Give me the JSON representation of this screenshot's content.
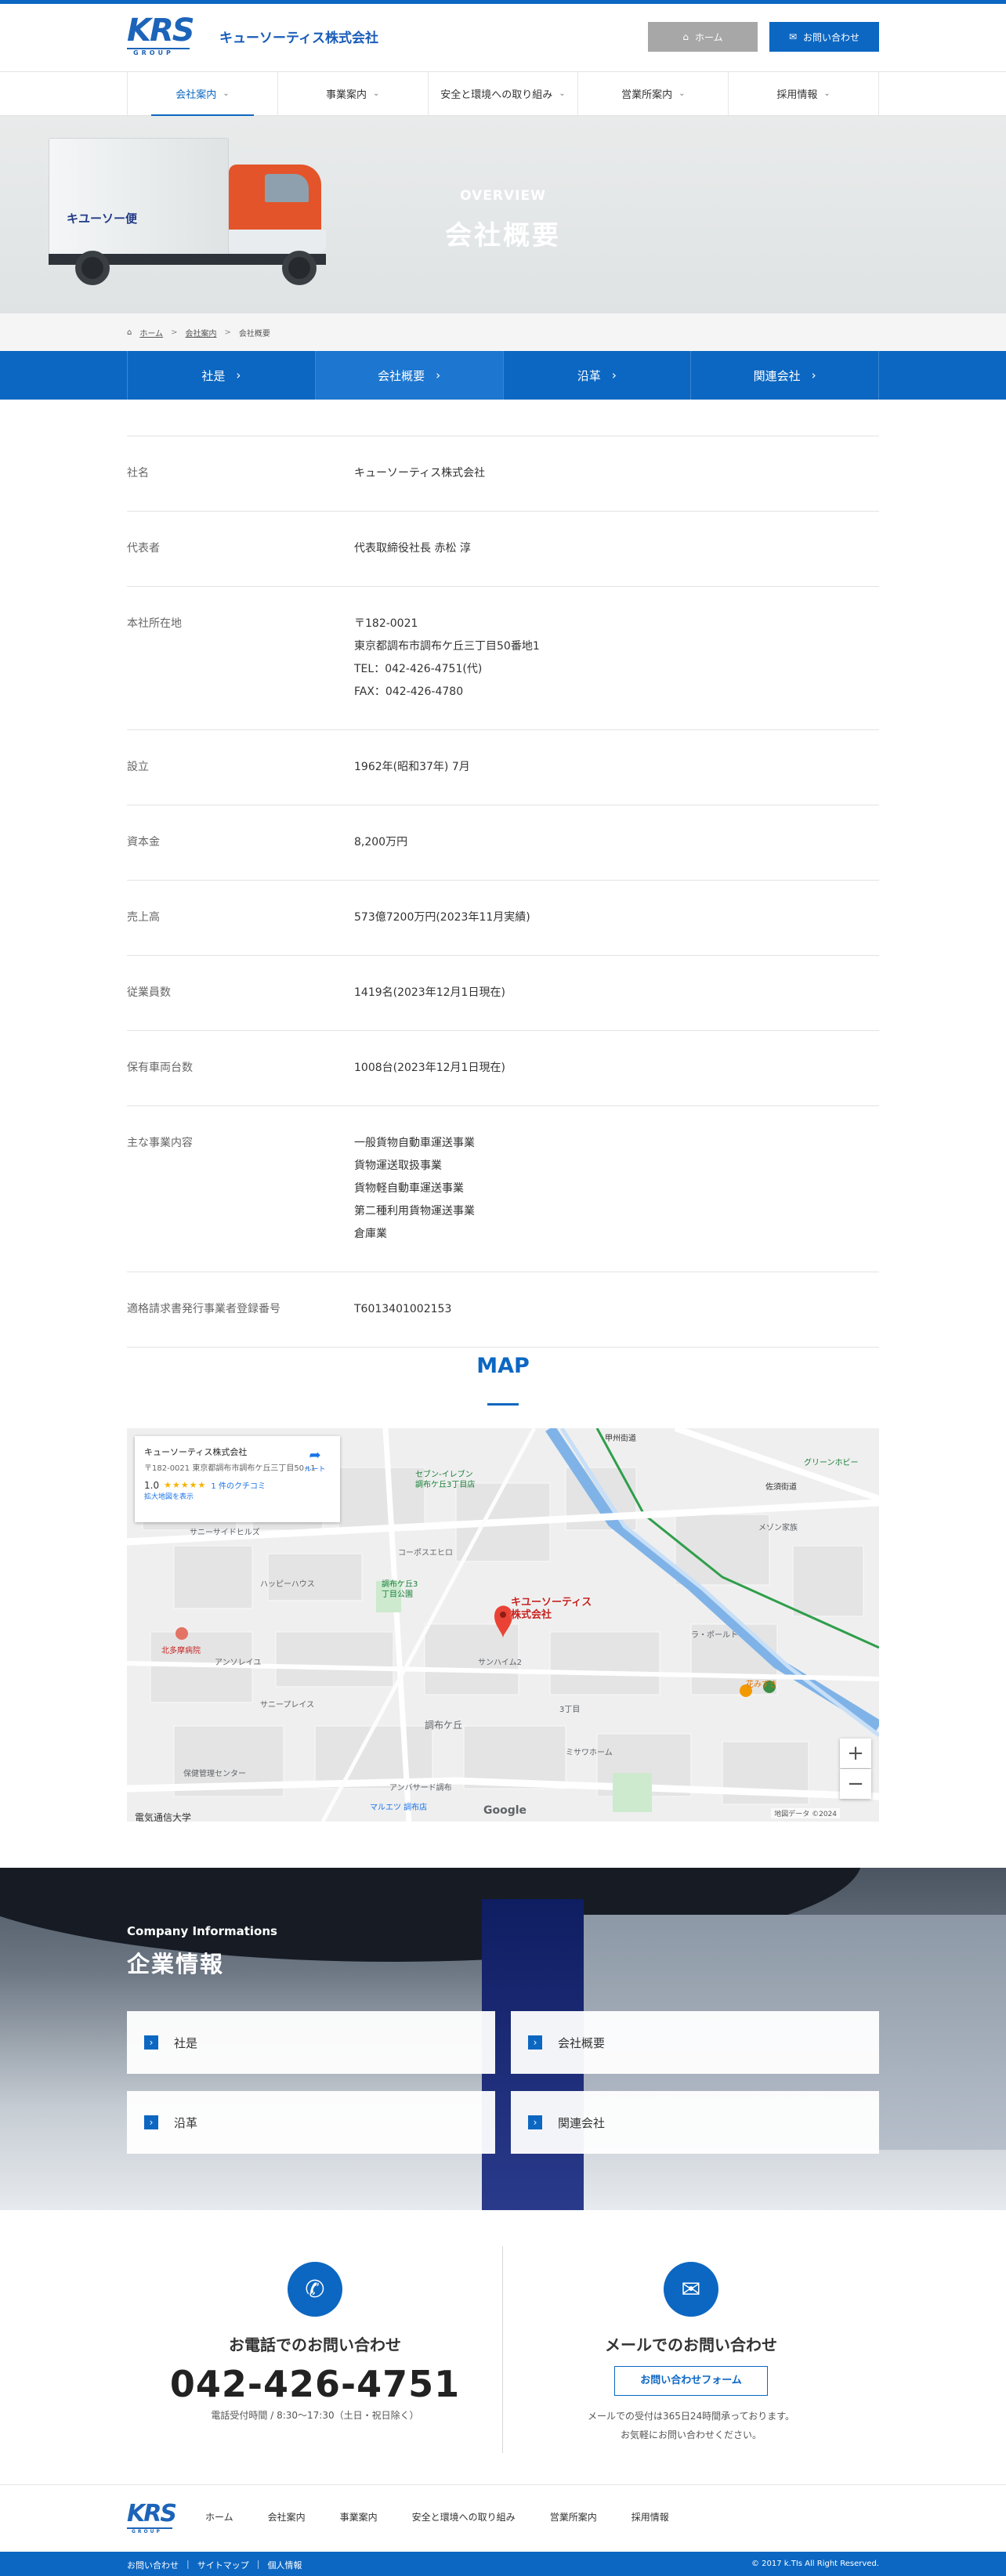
{
  "header": {
    "logo_text": "KRS",
    "logo_sub": "GROUP",
    "company_name": "キューソーティス株式会社",
    "home_button": "ホーム",
    "contact_button": "お問い合わせ"
  },
  "global_nav": [
    {
      "label": "会社案内"
    },
    {
      "label": "事業案内"
    },
    {
      "label": "安全と環境への取り組み"
    },
    {
      "label": "営業所案内"
    },
    {
      "label": "採用情報"
    }
  ],
  "hero": {
    "title_en": "OVERVIEW",
    "title_ja": "会社概要",
    "truck_text": "キユーソー便"
  },
  "breadcrumb": {
    "home": "ホーム",
    "parent": "会社案内",
    "current": "会社概要"
  },
  "sub_nav": [
    {
      "label": "社是"
    },
    {
      "label": "会社概要"
    },
    {
      "label": "沿革"
    },
    {
      "label": "関連会社"
    }
  ],
  "company": [
    {
      "label": "社名",
      "lines": [
        "キューソーティス株式会社"
      ]
    },
    {
      "label": "代表者",
      "lines": [
        "代表取締役社長 赤松 淳"
      ]
    },
    {
      "label": "本社所在地",
      "lines": [
        "〒182-0021",
        "東京都調布市調布ケ丘三丁目50番地1",
        "TEL：042-426-4751(代)",
        "FAX：042-426-4780"
      ]
    },
    {
      "label": "設立",
      "lines": [
        "1962年(昭和37年) 7月"
      ]
    },
    {
      "label": "資本金",
      "lines": [
        "8,200万円"
      ]
    },
    {
      "label": "売上高",
      "lines": [
        "573億7200万円(2023年11月実績)"
      ]
    },
    {
      "label": "従業員数",
      "lines": [
        "1419名(2023年12月1日現在)"
      ]
    },
    {
      "label": "保有車両台数",
      "lines": [
        "1008台(2023年12月1日現在)"
      ]
    },
    {
      "label": "主な事業内容",
      "lines": [
        "一般貨物自動車運送事業",
        "貨物運送取扱事業",
        "貨物軽自動車運送事業",
        "第二種利用貨物運送事業",
        "倉庫業"
      ]
    },
    {
      "label": "適格請求書発行事業者登録番号",
      "lines": [
        "T6013401002153"
      ]
    }
  ],
  "map": {
    "title": "MAP",
    "card_name": "キューソーティス株式会社",
    "card_address": "〒182-0021 東京都調布市調布ケ丘三丁目50−1",
    "rating": "1.0",
    "stars": "★★★★★",
    "review_count": "1 件のクチコミ",
    "larger_map": "拡大地図を表示",
    "directions": "ルート",
    "pin_label_1": "キユーソーティス",
    "pin_label_2": "株式会社",
    "labels": [
      "セブン-イレブン",
      "調布ケ丘3丁目店",
      "グリーンホビー",
      "サニーサイドヒルズ",
      "ハッピーハウス",
      "北多摩病院",
      "調布ケ丘3",
      "丁目公園",
      "アンソレイユ",
      "サニープレイス",
      "調布ケ丘",
      "3丁目",
      "マルエツ 調布店",
      "保健管理センター",
      "電気通信大学",
      "甲州街道",
      "佐須街道",
      "花みずき",
      "アンバサード調布",
      "サンハイム2",
      "メゾン家族",
      "ラ・ポールト",
      "コーポスエヒロ",
      "ミサワホーム"
    ],
    "zoom_in": "+",
    "zoom_out": "−",
    "copyright": "地図データ ©2024",
    "google": "Google"
  },
  "info": {
    "title_en": "Company Informations",
    "title_ja": "企業情報",
    "cards": [
      {
        "label": "社是"
      },
      {
        "label": "会社概要"
      },
      {
        "label": "沿革"
      },
      {
        "label": "関連会社"
      }
    ]
  },
  "contact": {
    "phone_heading": "お電話でのお問い合わせ",
    "phone_number": "042-426-4751",
    "phone_hours": "電話受付時間 / 8:30〜17:30（土日・祝日除く）",
    "mail_heading": "メールでのお問い合わせ",
    "mail_button": "お問い合わせフォーム",
    "mail_note_1": "メールでの受付は365日24時間承っております。",
    "mail_note_2": "お気軽にお問い合わせください。"
  },
  "footer": {
    "links": [
      "ホーム",
      "会社案内",
      "事業案内",
      "安全と環境への取り組み",
      "営業所案内",
      "採用情報"
    ],
    "bottom_links": [
      "お問い合わせ",
      "サイトマップ",
      "個人情報"
    ],
    "copyright": "© 2017 k.TIs All Right Reserved."
  },
  "colors": {
    "primary": "#0c67c2",
    "gray_button": "#a7a7a7",
    "cab": "#e3542a"
  }
}
